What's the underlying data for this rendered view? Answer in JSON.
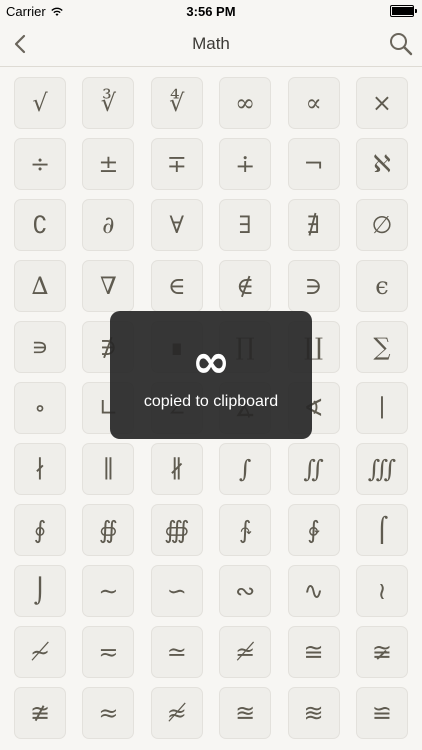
{
  "status": {
    "carrier": "Carrier",
    "time": "3:56 PM",
    "battery_level": 0.95
  },
  "nav": {
    "title": "Math",
    "back_icon": "chevron-left-icon",
    "search_icon": "search-icon"
  },
  "symbols": [
    "√",
    "∛",
    "∜",
    "∞",
    "∝",
    "×",
    "÷",
    "±",
    "∓",
    "∔",
    "¬",
    "ℵ",
    "∁",
    "∂",
    "∀",
    "∃",
    "∄",
    "∅",
    "∆",
    "∇",
    "∈",
    "∉",
    "∋",
    "ϵ",
    "∍",
    "∌",
    "∎",
    "∏",
    "∐",
    "∑",
    "∘",
    "∟",
    "∠",
    "∡",
    "∢",
    "∣",
    "∤",
    "∥",
    "∦",
    "∫",
    "∬",
    "∭",
    "∮",
    "∯",
    "∰",
    "∱",
    "∲",
    "⌠",
    "⌡",
    "∼",
    "∽",
    "∾",
    "∿",
    "≀",
    "≁",
    "≂",
    "≃",
    "≄",
    "≅",
    "≆",
    "≇",
    "≈",
    "≉",
    "≊",
    "≋",
    "≌"
  ],
  "toast": {
    "symbol": "∞",
    "message": "copied to clipboard"
  },
  "colors": {
    "background": "#f7f6f3",
    "tile": "#efeeea",
    "symbol": "#5f5b50",
    "toast": "#282828"
  }
}
